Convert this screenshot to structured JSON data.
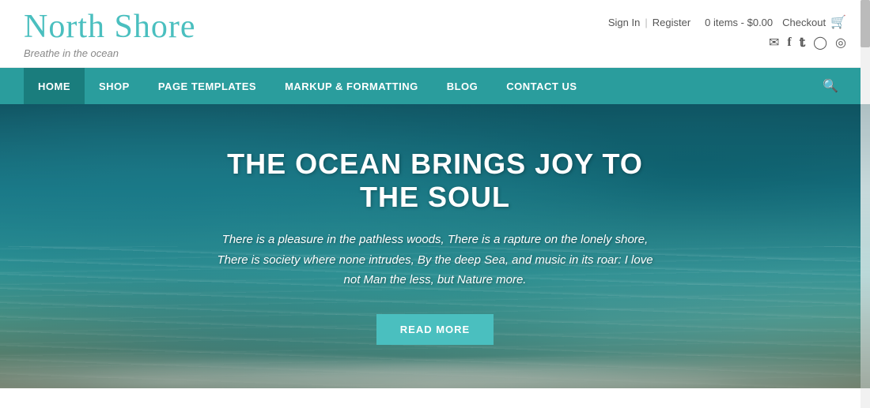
{
  "header": {
    "logo_title": "North Shore",
    "logo_subtitle": "Breathe in the ocean",
    "sign_in_label": "Sign In",
    "register_label": "Register",
    "cart_info": "0 items - $0.00",
    "checkout_label": "Checkout",
    "cart_icon": "🛒"
  },
  "social": {
    "email_icon": "✉",
    "facebook_icon": "f",
    "twitter_icon": "t",
    "instagram_icon": "📷",
    "tripadvisor_icon": "◎"
  },
  "nav": {
    "items": [
      {
        "label": "HOME",
        "active": true
      },
      {
        "label": "SHOP",
        "active": false
      },
      {
        "label": "PAGE TEMPLATES",
        "active": false
      },
      {
        "label": "MARKUP & FORMATTING",
        "active": false
      },
      {
        "label": "BLOG",
        "active": false
      },
      {
        "label": "CONTACT US",
        "active": false
      }
    ],
    "search_icon": "🔍"
  },
  "hero": {
    "title": "THE OCEAN BRINGS JOY TO THE SOUL",
    "text": "There is a pleasure in the pathless woods, There is a rapture on the lonely shore, There is society where none intrudes, By the deep Sea, and music in its roar: I love not Man the less, but Nature more.",
    "read_more_label": "READ MORE"
  }
}
